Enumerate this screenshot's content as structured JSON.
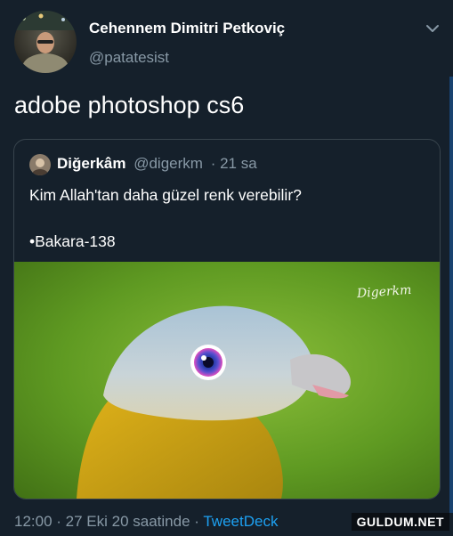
{
  "tweet": {
    "author_name": "Cehennem Dimitri Petkoviç",
    "author_handle": "@patatesist",
    "text": "adobe photoshop cs6",
    "footer": {
      "time": "12:00",
      "separator1": " · ",
      "date": "27 Eki 20 saatinde",
      "separator2": " · ",
      "source": "TweetDeck"
    }
  },
  "quoted": {
    "author_name": "Diğerkâm",
    "author_handle": "@digerkm",
    "time_ago": "· 21 sa",
    "line1": "Kim Allah'tan daha güzel renk verebilir?",
    "line2": "•Bakara-138",
    "image_signature": "Digerkm"
  },
  "watermark": "GULDUM.NET",
  "icons": {
    "menu": "chevron-down-icon"
  },
  "colors": {
    "background": "#15202b",
    "secondary_text": "#8899a6",
    "link": "#1da1f2",
    "border": "#38444d"
  }
}
